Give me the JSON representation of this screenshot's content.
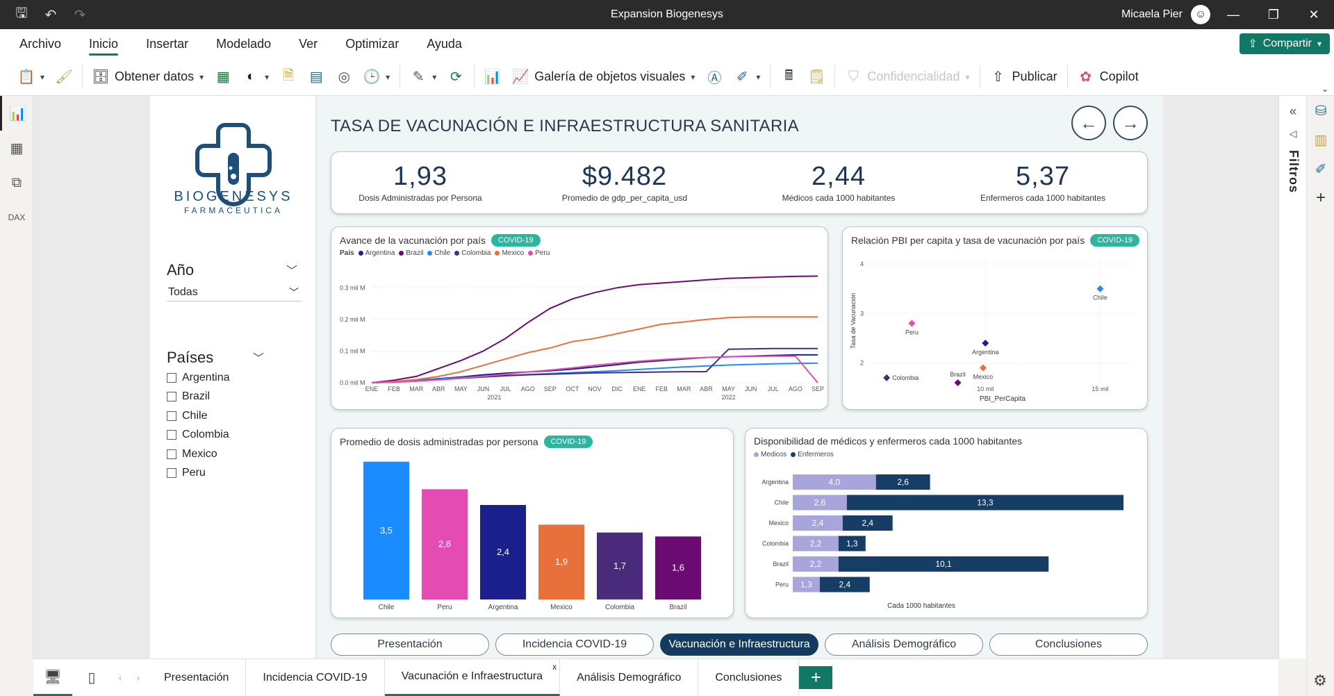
{
  "window": {
    "title": "Expansion Biogenesys",
    "user": "Micaela Pier"
  },
  "menu": {
    "items": [
      "Archivo",
      "Inicio",
      "Insertar",
      "Modelado",
      "Ver",
      "Optimizar",
      "Ayuda"
    ],
    "active": "Inicio",
    "share_label": "Compartir"
  },
  "ribbon": {
    "get_data": "Obtener datos",
    "visual_gallery": "Galería de objetos visuales",
    "confidentiality": "Confidencialidad",
    "publish": "Publicar",
    "copilot": "Copilot"
  },
  "panes": {
    "filters_label": "Filtros"
  },
  "brand": {
    "name": "BIOGENESYS",
    "subtitle": "FARMACEUTICA",
    "color": "#1d4f78"
  },
  "slicers": {
    "year": {
      "title": "Año",
      "value": "Todas"
    },
    "countries": {
      "title": "Países",
      "options": [
        "Argentina",
        "Brazil",
        "Chile",
        "Colombia",
        "Mexico",
        "Peru"
      ]
    }
  },
  "report": {
    "title": "TASA DE VACUNACIÓN E INFRAESTRUCTURA SANITARIA",
    "kpis": [
      {
        "value": "1,93",
        "label": "Dosis Administradas por Persona"
      },
      {
        "value": "$9.482",
        "label": "Promedio de gdp_per_capita_usd"
      },
      {
        "value": "2,44",
        "label": "Médicos cada 1000 habitantes"
      },
      {
        "value": "5,37",
        "label": "Enfermeros cada 1000 habitantes"
      }
    ],
    "badge": "COVID-19",
    "page_buttons": [
      "Presentación",
      "Incidencia COVID-19",
      "Vacunación e Infraestructura",
      "Análisis Demográfico",
      "Conclusiones"
    ],
    "active_page": "Vacunación e Infraestructura"
  },
  "tabs": {
    "items": [
      "Presentación",
      "Incidencia COVID-19",
      "Vacunación e Infraestructura",
      "Análisis Demográfico",
      "Conclusiones"
    ],
    "active": "Vacunación e Infraestructura",
    "close": "x"
  },
  "colors": {
    "Argentina": "#1a1f8c",
    "Brazil": "#6b0a73",
    "Chile": "#1a8cff",
    "Colombia": "#4a2a7a",
    "Mexico": "#e8703a",
    "Peru": "#e44cb4",
    "medicos": "#a8a4dc",
    "enfermeros": "#163d66",
    "accent": "#117865"
  },
  "chart_data": [
    {
      "type": "line",
      "title": "Avance de la vacunación por país",
      "legend_title": "País",
      "x": [
        "ENE",
        "FEB",
        "MAR",
        "ABR",
        "MAY",
        "JUN",
        "JUL",
        "AGO",
        "SEP",
        "OCT",
        "NOV",
        "DIC",
        "ENE",
        "FEB",
        "MAR",
        "ABR",
        "MAY",
        "JUN",
        "JUL",
        "AGO",
        "SEP"
      ],
      "year_labels": [
        {
          "label": "2021",
          "index": 5.5
        },
        {
          "label": "2022",
          "index": 16
        }
      ],
      "y_ticks": [
        "0.0 mil M",
        "0.1 mil M",
        "0.2 mil M",
        "0.3 mil M"
      ],
      "ylim": [
        0,
        0.36
      ],
      "series": [
        {
          "name": "Argentina",
          "values": [
            0,
            0.003,
            0.008,
            0.013,
            0.018,
            0.025,
            0.03,
            0.034,
            0.038,
            0.043,
            0.05,
            0.057,
            0.065,
            0.07,
            0.075,
            0.08,
            0.082,
            0.084,
            0.086,
            0.088,
            0.088
          ]
        },
        {
          "name": "Brazil",
          "values": [
            0,
            0.008,
            0.02,
            0.045,
            0.07,
            0.1,
            0.14,
            0.19,
            0.235,
            0.265,
            0.285,
            0.3,
            0.31,
            0.315,
            0.32,
            0.325,
            0.33,
            0.332,
            0.334,
            0.336,
            0.337
          ]
        },
        {
          "name": "Chile",
          "values": [
            0,
            0.003,
            0.008,
            0.012,
            0.016,
            0.02,
            0.023,
            0.026,
            0.029,
            0.032,
            0.035,
            0.038,
            0.042,
            0.046,
            0.05,
            0.053,
            0.056,
            0.058,
            0.06,
            0.061,
            0.062
          ]
        },
        {
          "name": "Colombia",
          "values": [
            0,
            0.002,
            0.005,
            0.01,
            0.014,
            0.018,
            0.022,
            0.025,
            0.027,
            0.029,
            0.031,
            0.032,
            0.033,
            0.034,
            0.035,
            0.035,
            0.106,
            0.107,
            0.108,
            0.108,
            0.108
          ]
        },
        {
          "name": "Mexico",
          "values": [
            0,
            0.004,
            0.01,
            0.02,
            0.035,
            0.055,
            0.075,
            0.095,
            0.11,
            0.13,
            0.14,
            0.155,
            0.17,
            0.185,
            0.192,
            0.2,
            0.206,
            0.208,
            0.208,
            0.208,
            0.208
          ]
        },
        {
          "name": "Peru",
          "values": [
            0,
            0.002,
            0.005,
            0.009,
            0.014,
            0.02,
            0.027,
            0.034,
            0.04,
            0.047,
            0.055,
            0.062,
            0.068,
            0.073,
            0.077,
            0.08,
            0.082,
            0.083,
            0.084,
            0.084,
            0.0
          ]
        }
      ]
    },
    {
      "type": "scatter",
      "title": "Relación PBI per capita y tasa de vacunación por país",
      "xlabel": "PBI_PerCapita",
      "ylabel": "Tasa de Vacunación",
      "x_ticks": [
        {
          "label": "10 mil",
          "value": 10000
        },
        {
          "label": "15 mil",
          "value": 15000
        }
      ],
      "y_ticks": [
        2,
        3,
        4
      ],
      "xlim": [
        5000,
        16500
      ],
      "ylim": [
        1.6,
        4.1
      ],
      "points": [
        {
          "name": "Chile",
          "x": 15000,
          "y": 3.5
        },
        {
          "name": "Peru",
          "x": 6800,
          "y": 2.8
        },
        {
          "name": "Argentina",
          "x": 10000,
          "y": 2.4
        },
        {
          "name": "Colombia",
          "x": 5700,
          "y": 1.7
        },
        {
          "name": "Brazil",
          "x": 8800,
          "y": 1.6
        },
        {
          "name": "Mexico",
          "x": 9900,
          "y": 1.9
        }
      ]
    },
    {
      "type": "bar",
      "title": "Promedio de dosis administradas por persona",
      "categories": [
        "Chile",
        "Peru",
        "Argentina",
        "Mexico",
        "Colombia",
        "Brazil"
      ],
      "values": [
        3.5,
        2.8,
        2.4,
        1.9,
        1.7,
        1.6
      ],
      "labels": [
        "3,5",
        "2,8",
        "2,4",
        "1,9",
        "1,7",
        "1,6"
      ],
      "ylim": [
        0,
        3.6
      ]
    },
    {
      "type": "bar",
      "orientation": "horizontal-stacked",
      "title": "Disponibilidad de médicos y enfermeros cada 1000 habitantes",
      "xlabel": "Cada 1000 habitantes",
      "categories": [
        "Argentina",
        "Chile",
        "Mexico",
        "Colombia",
        "Brazil",
        "Peru"
      ],
      "series": [
        {
          "name": "Medicos",
          "values": [
            4.0,
            2.6,
            2.4,
            2.2,
            2.2,
            1.3
          ],
          "labels": [
            "4,0",
            "2,6",
            "2,4",
            "2,2",
            "2,2",
            "1,3"
          ]
        },
        {
          "name": "Enfermeros",
          "values": [
            2.6,
            13.3,
            2.4,
            1.3,
            10.1,
            2.4
          ],
          "labels": [
            "2,6",
            "13,3",
            "2,4",
            "1,3",
            "10,1",
            "2,4"
          ]
        }
      ],
      "xlim": [
        0,
        16.2
      ]
    }
  ]
}
